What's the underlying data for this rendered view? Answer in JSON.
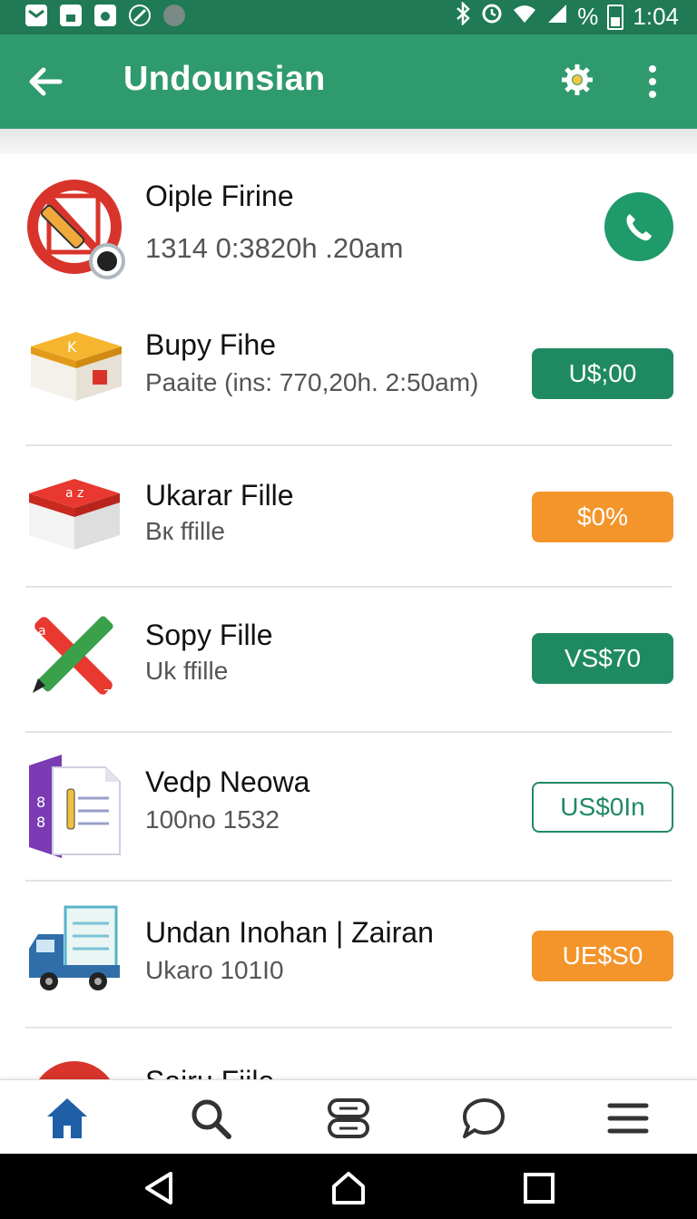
{
  "status_bar": {
    "icons_left": [
      "mail-icon",
      "lock-icon",
      "bag-icon",
      "no-disturb-icon",
      "account-icon"
    ],
    "bluetooth": "bluetooth-icon",
    "sync": "sync-icon",
    "battery_percent": "%",
    "time": "1:04"
  },
  "app_bar": {
    "title": "Undounsian",
    "back_icon": "arrow-left-icon",
    "settings_icon": "gear-icon",
    "more_icon": "more-vert-icon"
  },
  "items": [
    {
      "name": "Oiple Firine",
      "sub": "1314  0:3820h .20am",
      "action": "call",
      "icon": "no-edit-icon"
    },
    {
      "name": "Bupy Fihe",
      "sub": "Paaite (ins: 770,20h. 2:50am)",
      "badge": "U$;00",
      "badge_style": "green",
      "icon": "box-yellow-icon"
    },
    {
      "name": "Ukarar Fille",
      "sub": "Bк ffille",
      "badge": "$0%",
      "badge_style": "orange",
      "icon": "box-red-icon"
    },
    {
      "name": "Sopy Fille",
      "sub": "Uk ffille",
      "badge": "VS$70",
      "badge_style": "green",
      "icon": "tools-icon"
    },
    {
      "name": "Vedp Neowa",
      "sub": "100no 1532",
      "badge": "US$0In",
      "badge_style": "outline",
      "icon": "document-icon"
    },
    {
      "name": "Undan Inohan | Zairan",
      "sub": "Ukaro 101I0",
      "badge": "UE$S0",
      "badge_style": "orange",
      "icon": "truck-icon"
    },
    {
      "name": "Sairu Fiile",
      "sub": "",
      "badge": "",
      "badge_style": "green",
      "icon": "red-circle-icon"
    }
  ],
  "bottom_nav": [
    "home-icon",
    "search-icon",
    "list-icon",
    "chat-icon",
    "menu-icon"
  ],
  "system_nav": [
    "back-triangle-icon",
    "home-outline-icon",
    "recents-square-icon"
  ],
  "colors": {
    "primary": "#2f9a6e",
    "dark": "#1f7a55",
    "green_badge": "#1f8a62",
    "orange_badge": "#f4952b"
  }
}
